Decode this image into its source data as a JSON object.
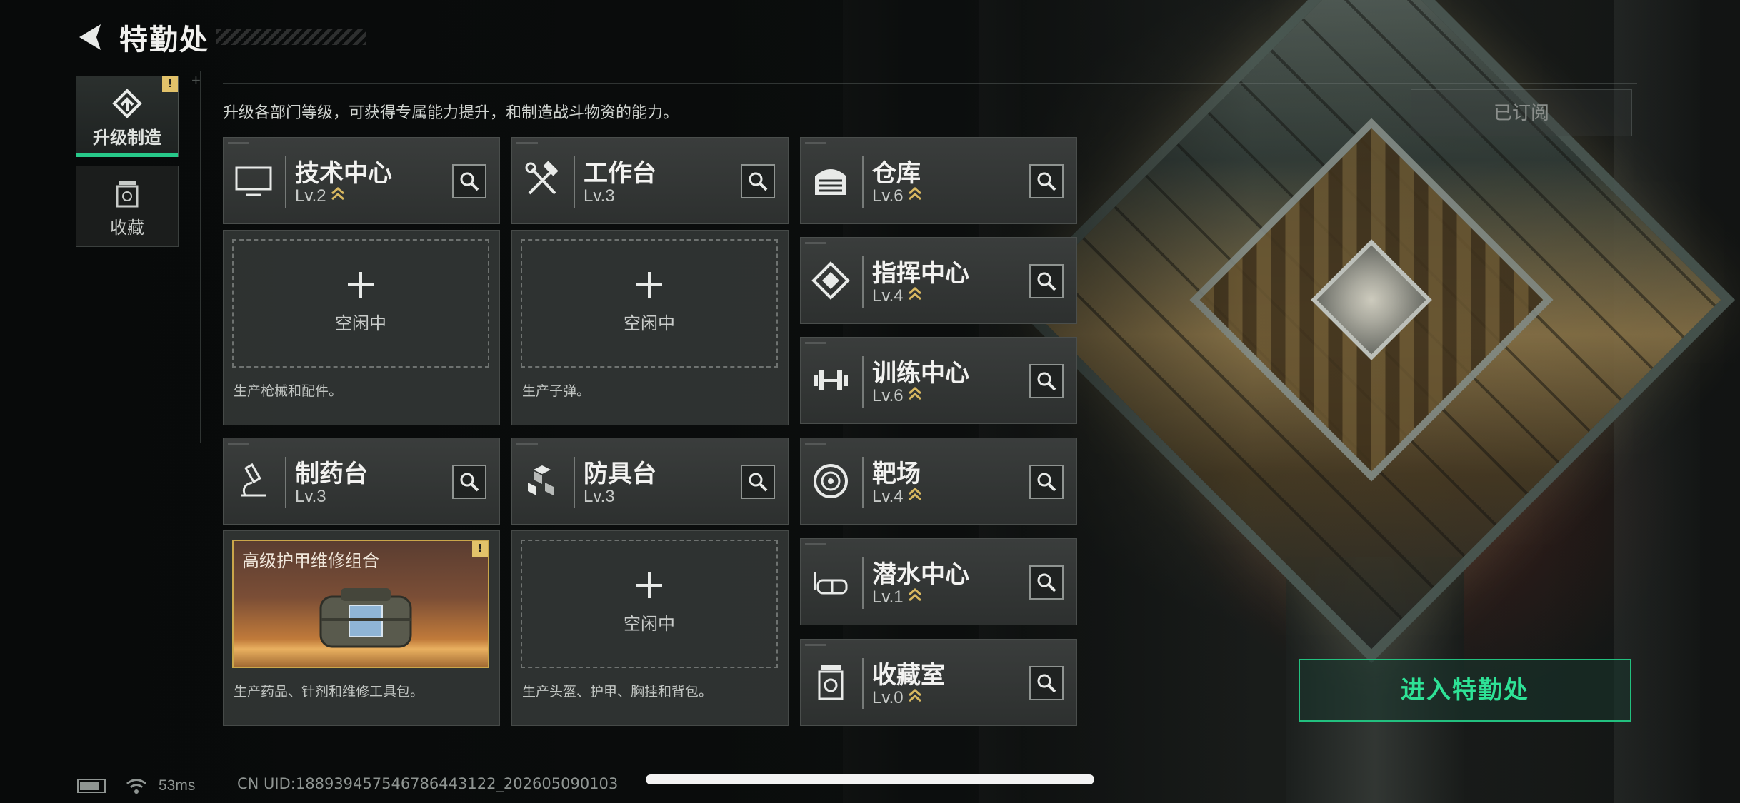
{
  "header": {
    "title": "特勤处"
  },
  "tabs": [
    {
      "label": "升级制造",
      "badge": "!"
    },
    {
      "label": "收藏"
    }
  ],
  "subtitle": "升级各部门等级，可获得专属能力提升，和制造战斗物资的能力。",
  "subscribed_label": "已订阅",
  "departments": {
    "tech": {
      "name": "技术中心",
      "level": "Lv.2"
    },
    "workbench": {
      "name": "工作台",
      "level": "Lv.3"
    },
    "warehouse": {
      "name": "仓库",
      "level": "Lv.6"
    },
    "command": {
      "name": "指挥中心",
      "level": "Lv.4"
    },
    "training": {
      "name": "训练中心",
      "level": "Lv.6"
    },
    "pharmacy": {
      "name": "制药台",
      "level": "Lv.3"
    },
    "armor": {
      "name": "防具台",
      "level": "Lv.3"
    },
    "range": {
      "name": "靶场",
      "level": "Lv.4"
    },
    "diving": {
      "name": "潜水中心",
      "level": "Lv.1"
    },
    "collection": {
      "name": "收藏室",
      "level": "Lv.0"
    }
  },
  "production": {
    "tech": {
      "status": "空闲中",
      "desc": "生产枪械和配件。"
    },
    "workbench": {
      "status": "空闲中",
      "desc": "生产子弹。"
    },
    "pharmacy": {
      "item": "高级护甲维修组合",
      "badge": "!",
      "desc": "生产药品、针剂和维修工具包。"
    },
    "armor": {
      "status": "空闲中",
      "desc": "生产头盔、护甲、胸挂和背包。"
    }
  },
  "enter_button": "进入特勤处",
  "status_bar": {
    "ping": "53ms",
    "uid": "CN UID:18893945754678644312​2_202605090103"
  },
  "colors": {
    "accent": "#27c98a",
    "gold": "#e2c26a"
  }
}
